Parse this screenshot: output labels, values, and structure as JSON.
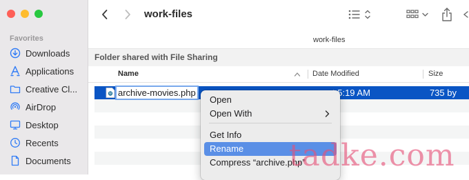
{
  "window": {
    "title": "work-files"
  },
  "sidebar": {
    "heading": "Favorites",
    "items": [
      {
        "label": "Downloads",
        "icon": "download-icon"
      },
      {
        "label": "Applications",
        "icon": "applications-icon"
      },
      {
        "label": "Creative Cl...",
        "icon": "folder-icon"
      },
      {
        "label": "AirDrop",
        "icon": "airdrop-icon"
      },
      {
        "label": "Desktop",
        "icon": "desktop-icon"
      },
      {
        "label": "Recents",
        "icon": "clock-icon"
      },
      {
        "label": "Documents",
        "icon": "document-icon"
      }
    ]
  },
  "pathbar": {
    "label": "work-files"
  },
  "shared_banner": {
    "text": "Folder shared with File Sharing"
  },
  "columns": {
    "name": "Name",
    "date": "Date Modified",
    "size": "Size"
  },
  "selected_file": {
    "name": "archive-movies.php",
    "date": "t 5:19 AM",
    "size": "735 by"
  },
  "context_menu": {
    "items": [
      "Open",
      "Open With",
      "Get Info",
      "Rename",
      "Compress “archive.php”"
    ],
    "highlighted": "Rename"
  },
  "watermark": {
    "text": "tadke.com"
  },
  "colors": {
    "selection": "#0a55c4",
    "menu_highlight": "#5a8fe6",
    "sidebar_icon": "#2f7bf6",
    "watermark": "#e55078"
  }
}
